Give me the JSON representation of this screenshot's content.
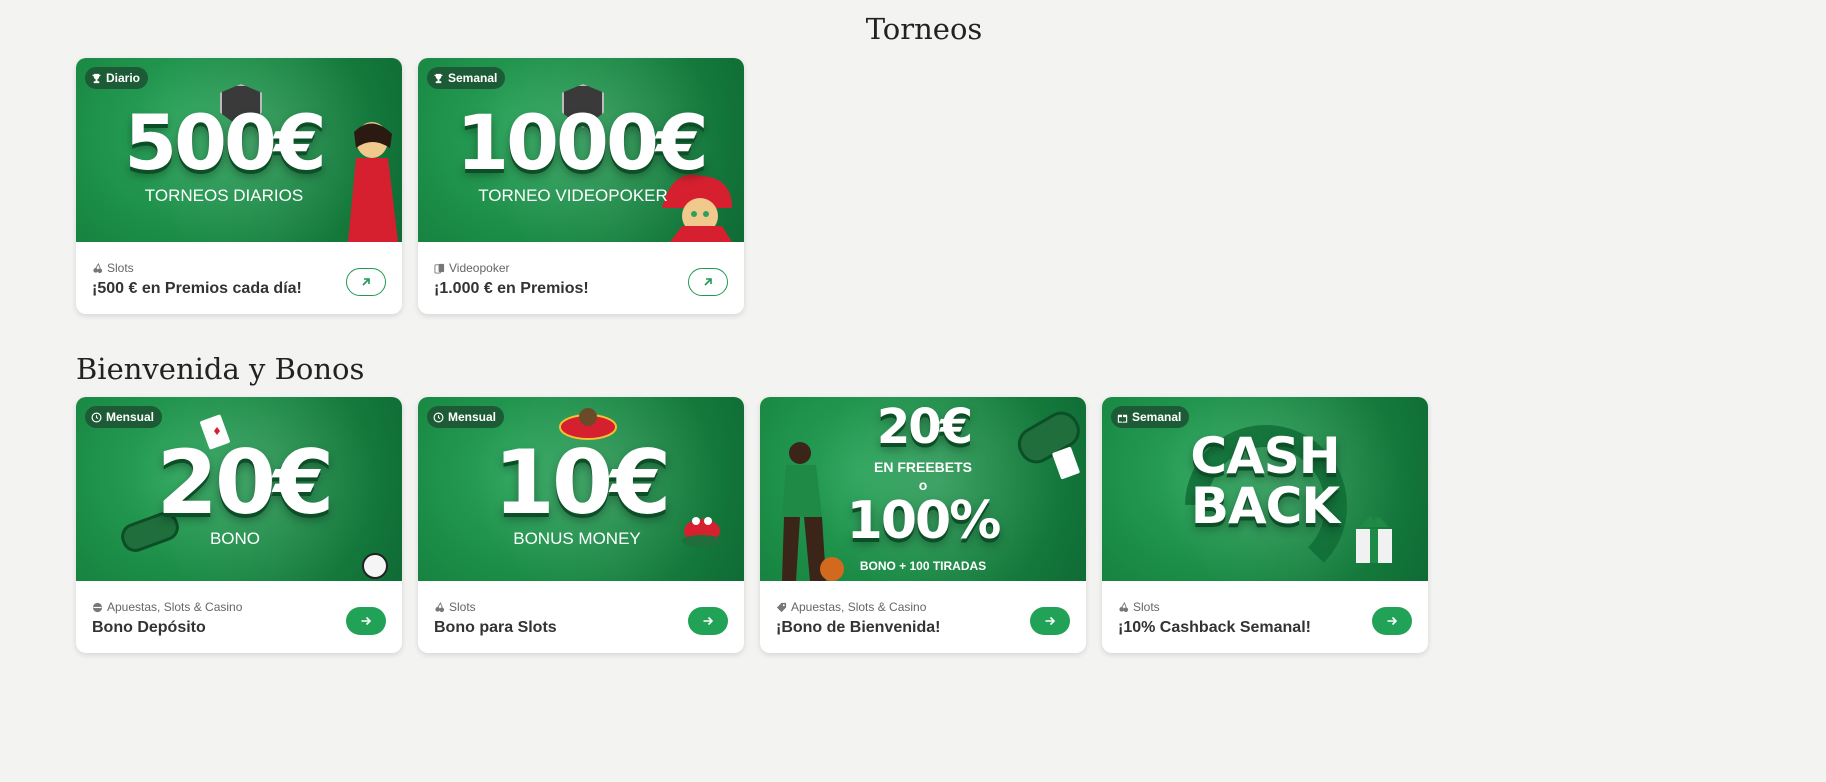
{
  "sections": {
    "torneos": {
      "title": "Torneos",
      "cards": [
        {
          "badge": "Diario",
          "headline": "500€",
          "subline": "TORNEOS DIARIOS",
          "category": "Slots",
          "title": "¡500 € en Premios cada día!",
          "button_icon": "arrow-up-right-icon"
        },
        {
          "badge": "Semanal",
          "headline": "1000€",
          "subline": "TORNEO VIDEOPOKER",
          "category": "Videopoker",
          "title": "¡1.000 € en Premios!",
          "button_icon": "arrow-up-right-icon"
        }
      ]
    },
    "bienvenida": {
      "title": "Bienvenida y Bonos",
      "cards": [
        {
          "badge": "Mensual",
          "headline": "20€",
          "subline": "BONO",
          "category": "Apuestas, Slots & Casino",
          "title": "Bono Depósito",
          "button_icon": "arrow-right-icon"
        },
        {
          "badge": "Mensual",
          "headline": "10€",
          "subline": "BONUS MONEY",
          "category": "Slots",
          "title": "Bono para Slots",
          "button_icon": "arrow-right-icon"
        },
        {
          "badge": "",
          "headline": "20€",
          "subline": "EN FREEBETS",
          "headline2": "100%",
          "subline2": "BONO + 100 TIRADAS",
          "connector": "o",
          "category": "Apuestas, Slots & Casino",
          "title": "¡Bono de Bienvenida!",
          "button_icon": "arrow-right-icon"
        },
        {
          "badge": "Semanal",
          "headline": "CASH",
          "headline2": "BACK",
          "category": "Slots",
          "title": "¡10% Cashback Semanal!",
          "button_icon": "arrow-right-icon"
        }
      ]
    }
  },
  "colors": {
    "brand_green": "#1a8a45",
    "button_green": "#22a256",
    "page_background": "#f3f3f1"
  }
}
